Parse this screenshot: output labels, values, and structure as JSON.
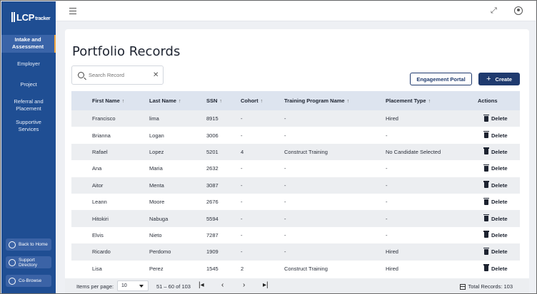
{
  "app": {
    "logo_text": "LCP",
    "logo_sub": "tracker"
  },
  "sidebar": {
    "items": [
      {
        "label_line1": "Intake and",
        "label_line2": "Assessment"
      },
      {
        "label_line1": "Employer",
        "label_line2": ""
      },
      {
        "label_line1": "Project",
        "label_line2": ""
      },
      {
        "label_line1": "Referral and",
        "label_line2": "Placement"
      },
      {
        "label_line1": "Supportive",
        "label_line2": "Services"
      }
    ],
    "bottom_buttons": [
      {
        "label_line1": "Back to Home",
        "label_line2": ""
      },
      {
        "label_line1": "Support",
        "label_line2": "Directory"
      },
      {
        "label_line1": "Co-Browse",
        "label_line2": ""
      }
    ]
  },
  "page": {
    "title": "Portfolio Records"
  },
  "search": {
    "placeholder": "Search Record",
    "value": ""
  },
  "actions": {
    "engagement_portal": "Engagement Portal",
    "create": "Create",
    "create_icon": "+"
  },
  "table": {
    "headers": {
      "first_name": "First Name",
      "last_name": "Last Name",
      "ssn": "SSN",
      "cohort": "Cohort",
      "training_program": "Training Program Name",
      "placement_type": "Placement Type",
      "actions": "Actions"
    },
    "sort_icon": "↑",
    "delete_label": "Delete",
    "rows": [
      {
        "first": "Francisco",
        "last": "lima",
        "ssn": "8915",
        "cohort": "-",
        "program": "-",
        "placement": "Hired"
      },
      {
        "first": "Brianna",
        "last": "Logan",
        "ssn": "3006",
        "cohort": "-",
        "program": "-",
        "placement": "-"
      },
      {
        "first": "Rafael",
        "last": "Lopez",
        "ssn": "5201",
        "cohort": "4",
        "program": "Construct Training",
        "placement": "No Candidate Selected"
      },
      {
        "first": "Ana",
        "last": "Maria",
        "ssn": "2632",
        "cohort": "-",
        "program": "-",
        "placement": "-"
      },
      {
        "first": "Aitor",
        "last": "Menta",
        "ssn": "3087",
        "cohort": "-",
        "program": "-",
        "placement": "-"
      },
      {
        "first": "Leann",
        "last": "Moore",
        "ssn": "2676",
        "cohort": "-",
        "program": "-",
        "placement": "-"
      },
      {
        "first": "Hitokiri",
        "last": "Nabuga",
        "ssn": "5594",
        "cohort": "-",
        "program": "-",
        "placement": "-"
      },
      {
        "first": "Elvis",
        "last": "Nieto",
        "ssn": "7287",
        "cohort": "-",
        "program": "-",
        "placement": "-"
      },
      {
        "first": "Ricardo",
        "last": "Perdomo",
        "ssn": "1909",
        "cohort": "-",
        "program": "-",
        "placement": "Hired"
      },
      {
        "first": "Lisa",
        "last": "Perez",
        "ssn": "1545",
        "cohort": "2",
        "program": "Construct Training",
        "placement": "Hired"
      }
    ]
  },
  "pagination": {
    "items_per_page_label": "Items per page:",
    "items_per_page_value": "10",
    "range": "51 – 60 of 103",
    "first": "|◂",
    "prev": "‹",
    "next": "›",
    "last": "▸|",
    "total_records": "Total Records: 103"
  },
  "colors": {
    "sidebar": "#1f4e93",
    "primary": "#1f3a6e",
    "active_indicator": "#f0a640",
    "table_header": "#dde4ef"
  }
}
